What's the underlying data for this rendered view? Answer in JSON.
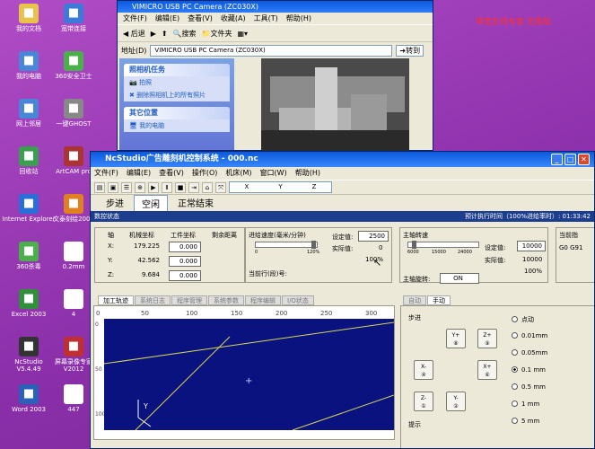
{
  "desktop": {
    "icons": [
      {
        "label": "我的文档",
        "glyph": "folder-icon",
        "color": "#e8c24a"
      },
      {
        "label": "我的电脑",
        "glyph": "computer-icon",
        "color": "#4a86d6"
      },
      {
        "label": "网上邻居",
        "glyph": "network-icon",
        "color": "#4a86d6"
      },
      {
        "label": "回收站",
        "glyph": "recycle-bin-icon",
        "color": "#3aa050"
      },
      {
        "label": "Internet Explorer",
        "glyph": "ie-icon",
        "color": "#2a6fd8"
      },
      {
        "label": "360杀毒",
        "glyph": "antivirus-icon",
        "color": "#4ab04a"
      },
      {
        "label": "Excel 2003",
        "glyph": "excel-icon",
        "color": "#2f8f3a"
      },
      {
        "label": "NcStudio V5.4.49",
        "glyph": "ncstudio-icon",
        "color": "#333333"
      },
      {
        "label": "Word 2003",
        "glyph": "word-icon",
        "color": "#2b5fb8"
      },
      {
        "label": "宽带连接",
        "glyph": "broadband-icon",
        "color": "#3b7ad8"
      },
      {
        "label": "360安全卫士",
        "glyph": "shield-icon",
        "color": "#4ab04a"
      },
      {
        "label": "一键GHOST",
        "glyph": "ghost-icon",
        "color": "#888888"
      },
      {
        "label": "ArtCAM pro",
        "glyph": "artcam-icon",
        "color": "#aa3333"
      },
      {
        "label": "文泰刻绘2002",
        "glyph": "wentai-icon",
        "color": "#e08020"
      },
      {
        "label": "0.2mm",
        "glyph": "file-icon",
        "color": "#ffffff"
      },
      {
        "label": "4",
        "glyph": "file-icon",
        "color": "#ffffff"
      },
      {
        "label": "屏幕录像专家V2012",
        "glyph": "recorder-icon",
        "color": "#c03030"
      },
      {
        "label": "447",
        "glyph": "file-icon",
        "color": "#ffffff"
      }
    ],
    "tray_text": "带宽在线专家  无限版"
  },
  "explorer": {
    "title": "VIMICRO USB PC Camera (ZC030X)",
    "menu": [
      "文件(F)",
      "编辑(E)",
      "查看(V)",
      "收藏(A)",
      "工具(T)",
      "帮助(H)"
    ],
    "back_label": "后退",
    "search_label": "搜索",
    "folders_label": "文件夹",
    "address_label": "地址(D)",
    "address_value": "VIMICRO USB PC Camera (ZC030X)",
    "go_label": "转到",
    "camera_tasks_title": "照相机任务",
    "camera_tasks": [
      "拍照",
      "删除照相机上的所有照片"
    ],
    "other_places_title": "其它位置",
    "other_places": [
      "我的电脑"
    ]
  },
  "nc": {
    "title": "NcStudio广告雕刻机控制系统 - 000.nc",
    "menu": [
      "文件(F)",
      "编辑(E)",
      "查看(V)",
      "操作(O)",
      "机床(M)",
      "窗口(W)",
      "帮助(H)"
    ],
    "coord_labels": [
      "X",
      "Y",
      "Z"
    ],
    "mode_tabs": [
      "步进",
      "空闲",
      "正常结束"
    ],
    "active_mode": 1,
    "status_left": "数控状态",
    "status_right": "预计执行时间（100%进给率时）: 01:33:42",
    "axis_header": [
      "轴",
      "机械坐标",
      "工件坐标",
      "剩余距离"
    ],
    "axes": [
      {
        "axis": "X:",
        "machine": "179.225",
        "work": "0.000"
      },
      {
        "axis": "Y:",
        "machine": "42.562",
        "work": "0.000"
      },
      {
        "axis": "Z:",
        "machine": "9.684",
        "work": "0.000"
      }
    ],
    "feed_title": "进给速度(毫米/分钟)",
    "feed_scale": [
      "0",
      "120%"
    ],
    "feed_set_label": "设定值:",
    "feed_set_value": "2500",
    "feed_actual_label": "实际值:",
    "feed_actual_value": "0",
    "feed_percent": "100%",
    "current_line_label": "当前行(段)号:",
    "spindle_title": "主轴转速",
    "spindle_scale": [
      "6000",
      "15000",
      "24000"
    ],
    "spindle_set_label": "设定值:",
    "spindle_set_value": "10000",
    "spindle_actual_label": "实际值:",
    "spindle_actual_value": "10000",
    "spindle_percent": "100%",
    "spindle_state_label": "主轴旋转:",
    "spindle_state_value": "ON",
    "current_cmd_label": "当前指",
    "current_cmd_value": "G0 G91",
    "view_tabs": [
      "加工轨迹",
      "系统日志",
      "程序管理",
      "系统参数",
      "程序编辑",
      "I/O状态"
    ],
    "ruler_top": [
      "0",
      "50",
      "100",
      "150",
      "200",
      "250",
      "300"
    ],
    "ruler_left": [
      "0",
      "50",
      "100"
    ],
    "right_tabs": [
      "自动",
      "手动"
    ],
    "step_label": "步进",
    "jog_buttons": [
      "Y+",
      "Z+",
      "X-",
      "X+",
      "Z-",
      "Y-"
    ],
    "step_options": [
      "点动",
      "0.01mm",
      "0.05mm",
      "0.1 mm",
      "0.5 mm",
      "1 mm",
      "5 mm"
    ],
    "selected_step": 3,
    "axis_marker": "Y",
    "hint_label": "提示"
  }
}
